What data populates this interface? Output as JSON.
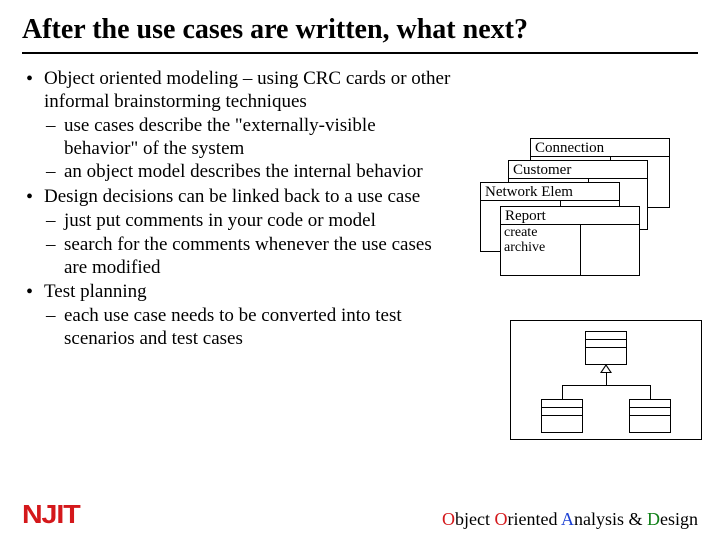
{
  "title": "After the use cases are written, what next?",
  "bullets": [
    {
      "text": "Object oriented modeling – using CRC cards or other informal brainstorming techniques",
      "sub": [
        "use cases describe the \"externally-visible behavior\" of the system",
        "an object model describes the internal behavior"
      ]
    },
    {
      "text": "Design decisions can be linked back to a use case",
      "sub": [
        "just put comments in your code or model",
        "search for the comments whenever the use cases are modified"
      ]
    },
    {
      "text": "Test planning",
      "sub": [
        "each use case needs to be converted into test scenarios and test cases"
      ]
    }
  ],
  "crc_cards": {
    "c0": "Connection",
    "c1": "Customer",
    "c2": "Network Elem",
    "c3": "Report",
    "resp1": "create",
    "resp2": "archive"
  },
  "footer": {
    "logo": "NJIT",
    "course_o": "O",
    "course_w1": "bject ",
    "course_o2": "O",
    "course_w2": "riented ",
    "course_a": "A",
    "course_w3": "nalysis & ",
    "course_d": "D",
    "course_w4": "esign"
  }
}
